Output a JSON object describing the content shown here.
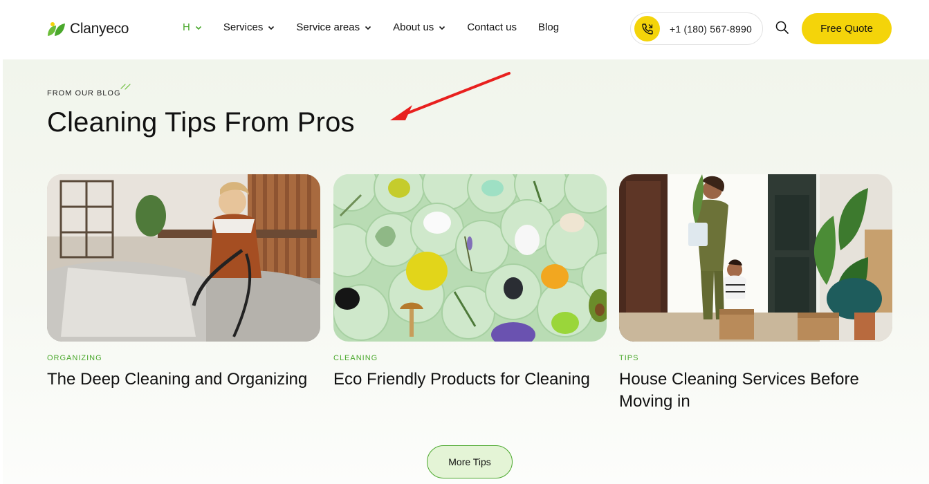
{
  "brand": {
    "name": "Clanyeco",
    "accent": "#4aa82c",
    "yellow": "#f4d40a"
  },
  "nav": {
    "items": [
      {
        "label": "H",
        "active": true,
        "dropdown": true
      },
      {
        "label": "Services",
        "active": false,
        "dropdown": true
      },
      {
        "label": "Service areas",
        "active": false,
        "dropdown": true
      },
      {
        "label": "About us",
        "active": false,
        "dropdown": true
      },
      {
        "label": "Contact us",
        "active": false,
        "dropdown": false
      },
      {
        "label": "Blog",
        "active": false,
        "dropdown": false
      }
    ]
  },
  "header": {
    "phone": "+1 (180) 567-8990",
    "phone_icon": "phone-call-icon",
    "search_icon": "search-icon",
    "quote_label": "Free Quote"
  },
  "blog": {
    "eyebrow": "FROM OUR BLOG",
    "title": "Cleaning Tips From Pros",
    "cards": [
      {
        "category": "ORGANIZING",
        "title": "The Deep Cleaning and Organizing",
        "image": "woman-vacuuming-sofa-photo"
      },
      {
        "category": "CLEANING",
        "title": "Eco Friendly Products for Cleaning",
        "image": "petri-dishes-natural-ingredients-photo"
      },
      {
        "category": "TIPS",
        "title": "House Cleaning Services Before Moving in",
        "image": "woman-and-child-moving-in-photo"
      }
    ],
    "more_label": "More Tips"
  },
  "annotation": {
    "type": "red-arrow",
    "color": "#e8201e"
  }
}
